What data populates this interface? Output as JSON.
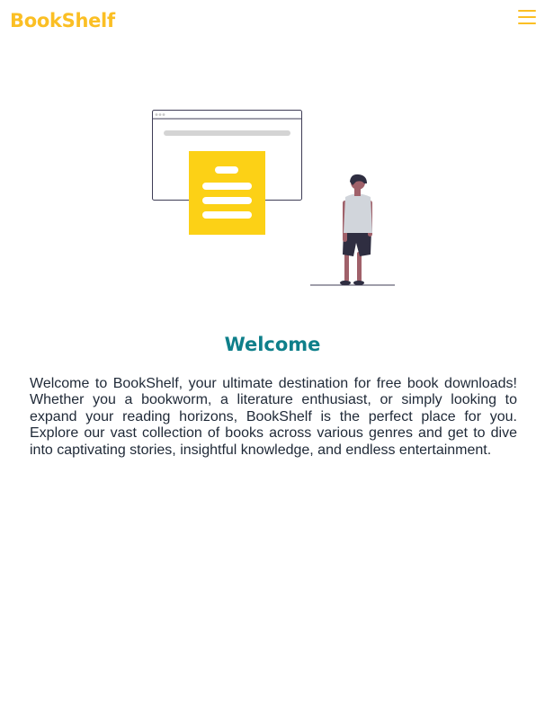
{
  "header": {
    "brand": "BookShelf",
    "menu_icon": "hamburger-menu-icon",
    "accent_color": "#fbbf24"
  },
  "hero": {
    "illustration": "reading-illustration",
    "illustration_colors": {
      "document": "#fcd116",
      "window_bar": "#d4d4d4",
      "person_shirt": "#d1d5db",
      "person_shorts": "#2f2e41",
      "person_skin": "#a0616a"
    }
  },
  "welcome": {
    "title": "Welcome",
    "title_color": "#0e7f8a",
    "text": "Welcome to BookShelf, your ultimate destination for free book downloads! Whether you a bookworm, a literature enthusiast, or simply looking to expand your reading horizons, BookShelf is the perfect place for you. Explore our vast collection of books across various genres and get to dive into captivating stories, insightful knowledge, and endless entertainment."
  }
}
